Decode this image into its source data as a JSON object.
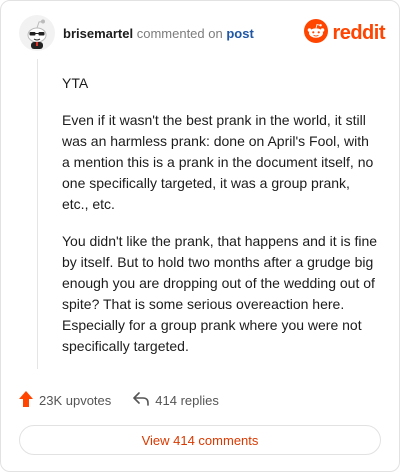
{
  "header": {
    "username": "brisemartel",
    "commented_on": "commented on",
    "post_link": "post",
    "brand": "reddit"
  },
  "comment": {
    "paragraphs": [
      "YTA",
      "Even if it wasn't the best prank in the world, it still was an harmless prank: done on April's Fool, with a mention this is a prank in the document itself, no one specifically targeted, it was a group prank, etc., etc.",
      "You didn't like the prank, that happens and it is fine by itself. But to hold two months after a grudge big enough you are dropping out of the wedding out of spite? That is some serious overeaction here. Especially for a group prank where you were not specifically targeted."
    ]
  },
  "actions": {
    "upvotes": "23K upvotes",
    "replies": "414 replies"
  },
  "view_button": "View 414 comments",
  "colors": {
    "brand": "#ff4500",
    "link": "#1f57a4",
    "view_button_text": "#d93900"
  },
  "icons": [
    "snoo-avatar-icon",
    "reddit-logo-icon",
    "upvote-arrow-icon",
    "reply-arrow-icon"
  ]
}
